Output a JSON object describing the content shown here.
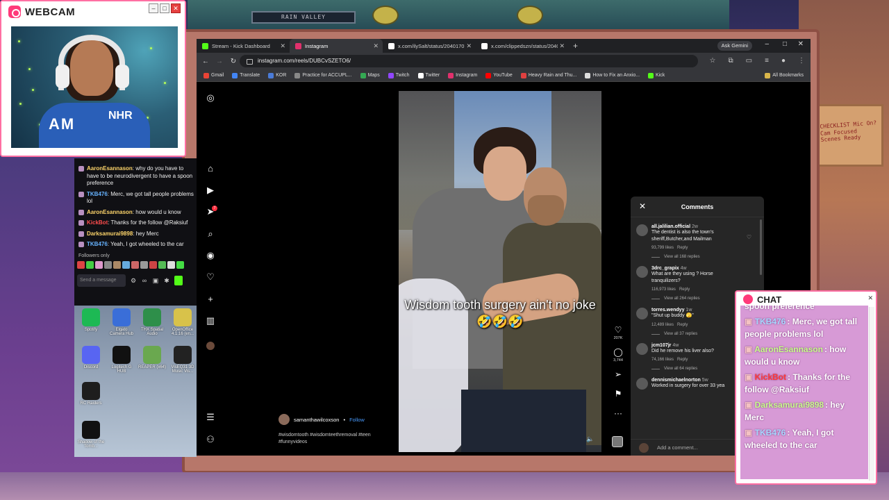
{
  "webcam": {
    "title": "WEBCAM",
    "jersey_text": "AM",
    "jersey_text2": "NHR"
  },
  "room": {
    "shelf_sign": "RAIN VALLEY",
    "note": "CHECKLIST Mic On? Cam Focused Scenes Ready"
  },
  "left_chat": {
    "messages": [
      {
        "user": "AaronEsannason",
        "user_color": "#ffd66b",
        "text": ": why do you have to have to be neurodivergent to have a spoon preference"
      },
      {
        "user": "TKB476",
        "user_color": "#66b3ff",
        "text": ": Merc, we got tall people problems lol"
      },
      {
        "user": "AaronEsannason",
        "user_color": "#ffd66b",
        "text": ": how would u know"
      },
      {
        "user": "KickBot",
        "user_color": "#ff4d4d",
        "text": ": Thanks for the follow @Raksiuf"
      },
      {
        "user": "Darksamurai9898",
        "user_color": "#ffd66b",
        "text": ": hey Merc"
      },
      {
        "user": "TKB476",
        "user_color": "#66b3ff",
        "text": ": Yeah, I got wheeled to the car"
      }
    ],
    "followers_only": "Followers only",
    "send_placeholder": "Send a message"
  },
  "desktop_icons": [
    {
      "label": "Spotify",
      "color": "#1db954"
    },
    {
      "label": "Elgato Camera Hub",
      "color": "#3a6ed8"
    },
    {
      "label": "THX Spatial Audio",
      "color": "#2e8f4a"
    },
    {
      "label": "OpenOffice 4.1.16 (en...",
      "color": "#d8c24a"
    },
    {
      "label": "Discord",
      "color": "#5865f2"
    },
    {
      "label": "Logitech G HUB",
      "color": "#111111"
    },
    {
      "label": "REAPER (x64)",
      "color": "#6aa84f"
    },
    {
      "label": "VisEQ31 3D Music Vis...",
      "color": "#222222"
    },
    {
      "label": "RC Raiders",
      "color": "#1e1e1e"
    },
    {
      "label": "Shadow of the Tomb...",
      "color": "#111111"
    }
  ],
  "browser": {
    "tabs": [
      {
        "label": "Stream - Kick Dashboard",
        "icon_color": "#53fc18",
        "active": false
      },
      {
        "label": "Instagram",
        "icon_color": "#e1306c",
        "active": true
      },
      {
        "label": "x.com/ilySalt/status/20401707",
        "icon_color": "#ffffff",
        "active": false
      },
      {
        "label": "x.com/clippedszn/status/20401",
        "icon_color": "#ffffff",
        "active": false
      }
    ],
    "ask_gemini": "Ask Gemini",
    "url": "instagram.com/reels/DUBCvSZETO6/",
    "bookmarks": [
      {
        "label": "Gmail",
        "color": "#ea4335"
      },
      {
        "label": "Translate",
        "color": "#4285f4"
      },
      {
        "label": "KOR",
        "color": "#4a7bd8"
      },
      {
        "label": "Practice for ACCUPL...",
        "color": "#888888"
      },
      {
        "label": "Maps",
        "color": "#34a853"
      },
      {
        "label": "Twitch",
        "color": "#9146ff"
      },
      {
        "label": "Twitter",
        "color": "#ffffff"
      },
      {
        "label": "Instagram",
        "color": "#e1306c"
      },
      {
        "label": "YouTube",
        "color": "#ff0000"
      },
      {
        "label": "Heavy Rain and Thu...",
        "color": "#e04040"
      },
      {
        "label": "How to Fix an Anxio...",
        "color": "#dddddd"
      },
      {
        "label": "Kick",
        "color": "#53fc18"
      }
    ],
    "all_bookmarks": "All Bookmarks"
  },
  "instagram": {
    "reel_caption": "Wisdom tooth surgery ain't no joke 🤣🤣🤣",
    "poster": {
      "username": "samanthawilcoxson",
      "follow": "Follow"
    },
    "hashtags": "#wisdomtooth #wisdomteethremoval #teen #funnyvideos",
    "like_count": "207K",
    "comment_count": "3,744",
    "notification_count": "7",
    "comments": {
      "title": "Comments",
      "items": [
        {
          "user": "all.jalilian.official",
          "time": "2w",
          "text": "The dentist is also the town's sheriff,Butcher,and Mailman",
          "likes": "93,799 likes",
          "reply": "Reply",
          "replies": "View all 168 replies"
        },
        {
          "user": "3drc_grapix",
          "time": "4w",
          "text": "What are they using ? Horse tranquilizers?",
          "likes": "116,973 likes",
          "reply": "Reply",
          "replies": "View all 264 replies"
        },
        {
          "user": "torres.wendyy",
          "time": "1w",
          "text": "\"Shut up buddy 🫣\"",
          "likes": "12,489 likes",
          "reply": "Reply",
          "replies": "View all 37 replies"
        },
        {
          "user": "jcm107jr",
          "time": "4w",
          "text": "Did he remove his liver also?",
          "likes": "74,166 likes",
          "reply": "Reply",
          "replies": "View all 64 replies"
        },
        {
          "user": "dennismichaelnorton",
          "time": "5w",
          "text": "Worked in surgery for over 33 yea",
          "likes": "",
          "reply": "",
          "replies": ""
        }
      ],
      "input_placeholder": "Add a comment..."
    }
  },
  "chat_overlay": {
    "title": "CHAT",
    "partial_top": "spoon preference",
    "messages": [
      {
        "user": "TKB476",
        "user_color": "#a8d8ff",
        "text": ": Merc, we got tall people problems lol"
      },
      {
        "user": "AaronEsannason",
        "user_color": "#c8ff8a",
        "text": ": how would u know"
      },
      {
        "user": "KickBot",
        "user_color": "#ff3a3a",
        "text": ": Thanks for the follow @Raksiuf"
      },
      {
        "user": "Darksamurai9898",
        "user_color": "#c8ff8a",
        "text": ": hey Merc"
      },
      {
        "user": "TKB476",
        "user_color": "#a8d8ff",
        "text": ": Yeah, I got wheeled to the car"
      }
    ]
  }
}
